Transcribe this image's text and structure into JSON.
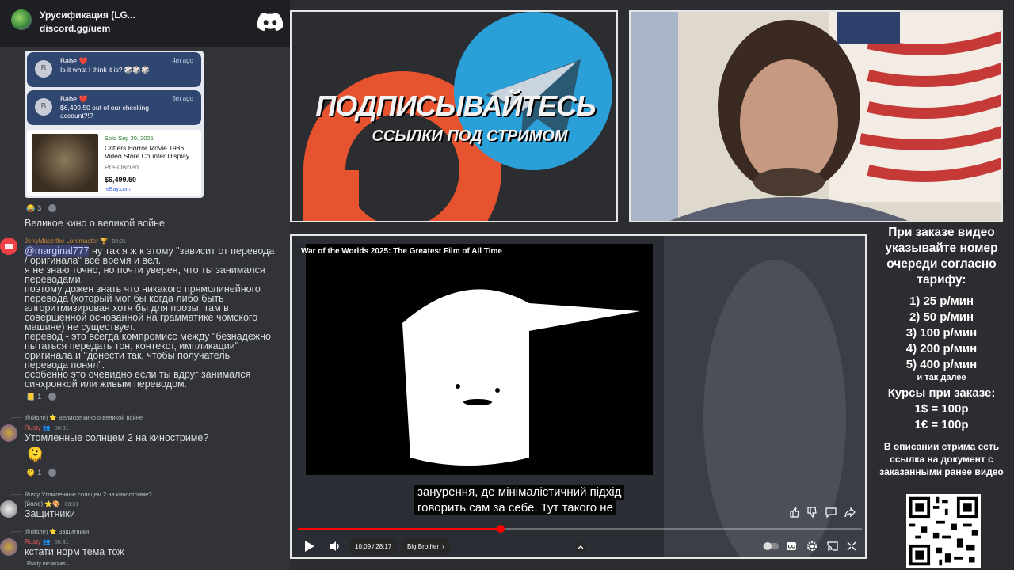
{
  "discord": {
    "server_name": "Урусификация (LG...",
    "invite": "discord.gg/uem",
    "screenshot": {
      "notifications": [
        {
          "avatar_letter": "B",
          "name": "Babe ❤️",
          "text": "Is it what I think it is? 🎲🎲🎲",
          "time": "4m ago"
        },
        {
          "avatar_letter": "B",
          "name": "Babe ❤️",
          "text": "$6,499.50 out of our checking account?!?",
          "time": "5m ago"
        }
      ],
      "ebay": {
        "sold": "Sold  Sep 20, 2025",
        "title": "Critters Horror Movie 1986 Video Store Counter Display",
        "condition": "Pre-Owned",
        "price": "$6,499.50",
        "site": "eBay.com"
      }
    },
    "reaction1": {
      "emoji": "😂",
      "count": "3"
    },
    "msg_kino": "Великое кино о великой войне",
    "jerry": {
      "username": "JerryMacc the Loremaster",
      "badge": "🏆",
      "time": "00:31",
      "mention": "@marginal777",
      "lines": [
        " ну так я ж к этому \"зависит от перевода",
        "/ оригинала\" все время и вел.",
        "я не знаю точно, но почти уверен, что ты занимался",
        "переводами.",
        "поэтому дожен знать что никакого прямолинейного",
        "перевода (который мог бы когда либо быть",
        "алгоритмизирован хотя бы для прозы, там в",
        "совершенной основанной на грамматике чомского",
        "машине) не существует.",
        "перевод - это всегда компромисс между \"безнадежно",
        "пытаться передать тон, контекст, импликации\"",
        "оригинала и \"донести так, чтобы получатель",
        "перевода понял\".",
        "особенно это очевидно если ты вдруг занимался",
        "синхронкой или живым переводом."
      ],
      "reaction": {
        "emoji": "📒",
        "count": "1"
      }
    },
    "rusty1": {
      "reply_text": "@(йоле) ⭐ Великое кино о великой войне",
      "username": "Rusty",
      "badge": "👥",
      "time": "00:31",
      "text": "Утомленные солнцем 2 на киностриме?",
      "emoji": "🫠",
      "reaction": {
        "emoji": "🫠",
        "count": "1"
      }
    },
    "yole": {
      "reply_text": "Rusty Утомленные солнцем 2 на киностриме?",
      "username": "(йоле)",
      "badge": "⭐🎨",
      "time": "00:31",
      "text": "Защитники"
    },
    "rusty2": {
      "reply_text": "@(йоле) ⭐ Защитники",
      "username": "Rusty",
      "badge": "👥",
      "time": "00:31",
      "text": "кстати норм тема тож"
    },
    "typing": "Rusty печатает..."
  },
  "promo": {
    "heading": "ПОДПИСЫВАЙТЕСЬ",
    "sub": "ССЫЛКИ ПОД СТРИМОМ",
    "colors": {
      "boosty": "#e8532f",
      "telegram": "#2a9fd8"
    }
  },
  "player": {
    "title": "War of the Worlds 2025: The Greatest Film of All Time",
    "subtitle_lines": [
      "занурення, де мінімалістичний підхід",
      "говорить сам за себе.  Тут такого не"
    ],
    "time_current": "10:09",
    "time_total": "28:17",
    "chapter": "Big Brother",
    "progress": 0.36,
    "icons": [
      "play-icon",
      "volume-icon",
      "like-icon",
      "dislike-icon",
      "comment-icon",
      "share-icon",
      "autoplay-toggle",
      "cc-icon",
      "settings-icon",
      "cast-icon",
      "fullscreen-icon"
    ]
  },
  "info": {
    "header": "При заказе видео указывайте номер очереди согласно тарифу:",
    "tariffs": [
      "1) 25 р/мин",
      "2) 50 р/мин",
      "3) 100 р/мин",
      "4) 200 р/мин",
      "5) 400 р/мин"
    ],
    "etc": "и так далее",
    "rates_header": "Курсы при заказе:",
    "rates": [
      "1$ = 100р",
      "1€ = 100р"
    ],
    "description": "В описании стрима есть ссылка на документ с заказанными ранее видео"
  }
}
